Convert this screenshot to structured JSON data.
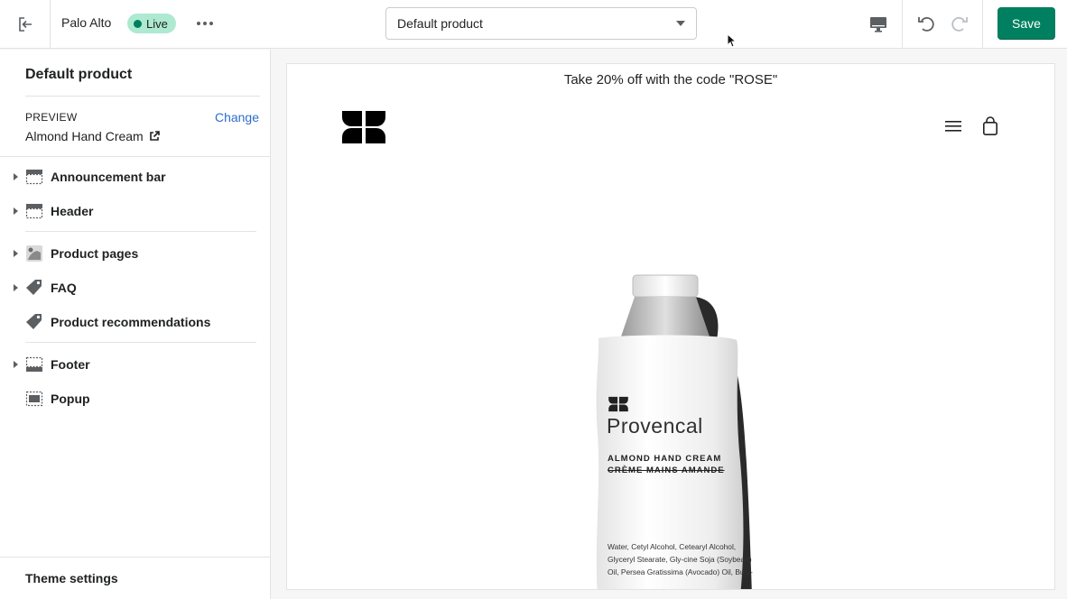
{
  "topbar": {
    "store_name": "Palo Alto",
    "status_badge": "Live",
    "template_select": "Default product",
    "save_label": "Save"
  },
  "sidebar": {
    "title": "Default product",
    "preview_label": "PREVIEW",
    "change_link": "Change",
    "preview_value": "Almond Hand Cream",
    "sections": [
      {
        "label": "Announcement bar",
        "icon": "section-layout-icon",
        "expandable": true
      },
      {
        "label": "Header",
        "icon": "section-layout-icon",
        "expandable": true
      },
      {
        "label": "Product pages",
        "icon": "product-image-icon",
        "expandable": true
      },
      {
        "label": "FAQ",
        "icon": "tag-icon",
        "expandable": true
      },
      {
        "label": "Product recommendations",
        "icon": "tag-icon",
        "expandable": false
      },
      {
        "label": "Footer",
        "icon": "section-layout-icon",
        "expandable": true
      },
      {
        "label": "Popup",
        "icon": "section-layout-icon",
        "expandable": false
      }
    ],
    "theme_settings": "Theme settings"
  },
  "preview": {
    "announcement": "Take 20% off with the code \"ROSE\"",
    "product": {
      "brand": "Provencal",
      "subtitle_en": "ALMOND HAND CREAM",
      "subtitle_fr": "CRÈME MAINS AMANDE",
      "ingredients": "Water, Cetyl Alcohol, Cetearyl Alcohol, Glyceryl Stearate, Gly-cine Soja (Soybean) Oil, Persea Gratissima (Avocado) Oil, Buty-"
    }
  },
  "colors": {
    "accent": "#008060",
    "live_badge": "#aee9d1",
    "link": "#2c6ecb"
  }
}
